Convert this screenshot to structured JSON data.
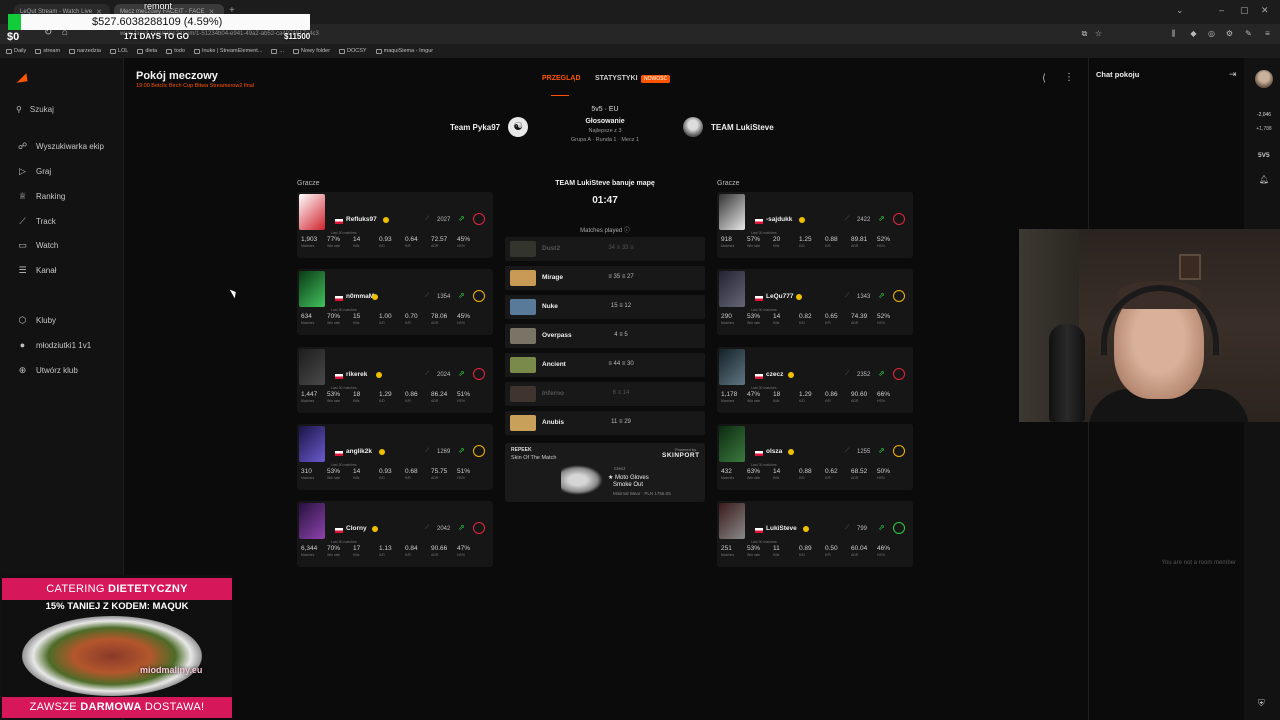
{
  "browser": {
    "tabs": [
      {
        "title": "LeQut Stream - Watch Live"
      },
      {
        "title": "Mecz meczowy FACEIT - FACE"
      }
    ],
    "url": "www.faceit.com/pl/cs2/room/1-51234b04-e941-49a2-ab52-ca4974817a4c3",
    "bookmarks": [
      "Daily",
      "stream",
      "narzedzia",
      "LOL",
      "dieta",
      "todo",
      "Inuke | StreamElement...",
      "...",
      "Nowy folder",
      "DOCSY",
      "maquiSiema - Imgur"
    ]
  },
  "overlay": {
    "title": "remont",
    "donation_amount": "$527.6038288109 (4.59%)",
    "current": "$0",
    "days": "171 DAYS TO GO",
    "goal": "$11500"
  },
  "nav": {
    "search_label": "Szukaj",
    "items": [
      {
        "label": "Wyszukiwarka ekip",
        "icon": "people-icon"
      },
      {
        "label": "Graj",
        "icon": "play-icon"
      },
      {
        "label": "Ranking",
        "icon": "ranking-icon"
      },
      {
        "label": "Track",
        "icon": "track-icon"
      },
      {
        "label": "Watch",
        "icon": "watch-icon"
      },
      {
        "label": "Kanał",
        "icon": "feed-icon"
      },
      {
        "label": "Kluby",
        "icon": "club-icon"
      },
      {
        "label": "młodziutki1 1v1",
        "icon": "avatar-icon"
      },
      {
        "label": "Utwórz klub",
        "icon": "plus-icon"
      }
    ]
  },
  "header": {
    "title": "Pokój meczowy",
    "subtitle": "19:00 Betclic Birch Cup Bitwa Streamerow2 final",
    "tab_overview": "PRZEGLĄD",
    "tab_stats": "STATYSTYKI",
    "new_badge": "NOWOŚĆ"
  },
  "match": {
    "team_left": "Team Pyka97",
    "team_right": "TEAM LukiSteve",
    "mode": "5v5 · EU",
    "status": "Głosowanie",
    "best_of": "Najlepsze z 3",
    "group": "Grupa A · Runda 1 · Mecz 1",
    "players_label": "Gracze"
  },
  "stat_keys": [
    "Matches",
    "Win rate",
    "Kills",
    "K/D",
    "K/R",
    "ADR",
    "HS%"
  ],
  "last30": "Last 30 matches",
  "team_left_players": [
    {
      "name": "Refluks97",
      "elo": "2027",
      "lvl": "10",
      "stats": [
        "1,903",
        "77%",
        "14",
        "0.93",
        "0.64",
        "72.57",
        "45%"
      ]
    },
    {
      "name": "n0mmaM",
      "elo": "1354",
      "lvl": "6",
      "stats": [
        "634",
        "70%",
        "15",
        "1.00",
        "0.70",
        "78.06",
        "45%"
      ]
    },
    {
      "name": "rikerek",
      "elo": "2024",
      "lvl": "10",
      "stats": [
        "1,447",
        "53%",
        "18",
        "1.29",
        "0.86",
        "86.24",
        "51%"
      ]
    },
    {
      "name": "anglik2k",
      "elo": "1269",
      "lvl": "6",
      "stats": [
        "310",
        "53%",
        "14",
        "0.93",
        "0.68",
        "75.75",
        "51%"
      ]
    },
    {
      "name": "Clorny",
      "elo": "2042",
      "lvl": "10",
      "stats": [
        "6,344",
        "70%",
        "17",
        "1.13",
        "0.84",
        "90.66",
        "47%"
      ]
    }
  ],
  "team_right_players": [
    {
      "name": "-sajdukk",
      "elo": "2422",
      "lvl": "10",
      "stats": [
        "918",
        "57%",
        "20",
        "1.25",
        "0.88",
        "89.81",
        "52%"
      ]
    },
    {
      "name": "LeQu777",
      "elo": "1343",
      "lvl": "6",
      "stats": [
        "290",
        "53%",
        "14",
        "0.82",
        "0.65",
        "74.39",
        "52%"
      ]
    },
    {
      "name": "czecz",
      "elo": "2352",
      "lvl": "10",
      "stats": [
        "1,178",
        "47%",
        "18",
        "1.29",
        "0.86",
        "90.60",
        "66%"
      ]
    },
    {
      "name": "olsza",
      "elo": "1255",
      "lvl": "6",
      "stats": [
        "432",
        "63%",
        "14",
        "0.88",
        "0.62",
        "68.52",
        "50%"
      ]
    },
    {
      "name": "LukiSteve",
      "elo": "799",
      "lvl": "1",
      "stats": [
        "251",
        "53%",
        "11",
        "0.89",
        "0.50",
        "60.04",
        "46%"
      ]
    }
  ],
  "veto": {
    "title": "TEAM LukiSteve banuje mapę",
    "timer": "01:47",
    "matches_played": "Matches played",
    "maps": [
      {
        "name": "Dust2",
        "score": "34 ≡ 33 ≡",
        "dim": true
      },
      {
        "name": "Mirage",
        "score": "≡ 35 ≡ 27",
        "dim": false
      },
      {
        "name": "Nuke",
        "score": "15 ≡ 12",
        "dim": false
      },
      {
        "name": "Overpass",
        "score": "4 ≡ 5",
        "dim": false
      },
      {
        "name": "Ancient",
        "score": "≡ 44 ≡ 30",
        "dim": false
      },
      {
        "name": "Inferno",
        "score": "6 ≡ 14",
        "dim": true
      },
      {
        "name": "Anubis",
        "score": "11 ≡ 29",
        "dim": false
      }
    ]
  },
  "skin": {
    "brand": "REPEEK",
    "title": "Skin Of The Match",
    "powered": "Powered by",
    "sponsor": "SKINPORT",
    "player": "czecz",
    "item1": "★ Moto Gloves",
    "item2": "Smoke Out",
    "wear": "Minimal Wear · PLN 1756.05"
  },
  "chat": {
    "title": "Chat pokoju",
    "empty": "You are not a room member"
  },
  "rightrail": {
    "count1": "-2,046",
    "count2": "+1,788",
    "mode": "5V5"
  },
  "ad": {
    "top_prefix": "CATERING ",
    "top_bold": "DIETETYCZNY",
    "promo": "15% TANIEJ Z KODEM: MAQUK",
    "brand": "miodmaliny.eu",
    "bottom_prefix": "ZAWSZE ",
    "bottom_bold": "DARMOWA",
    "bottom_suffix": " DOSTAWA!"
  }
}
